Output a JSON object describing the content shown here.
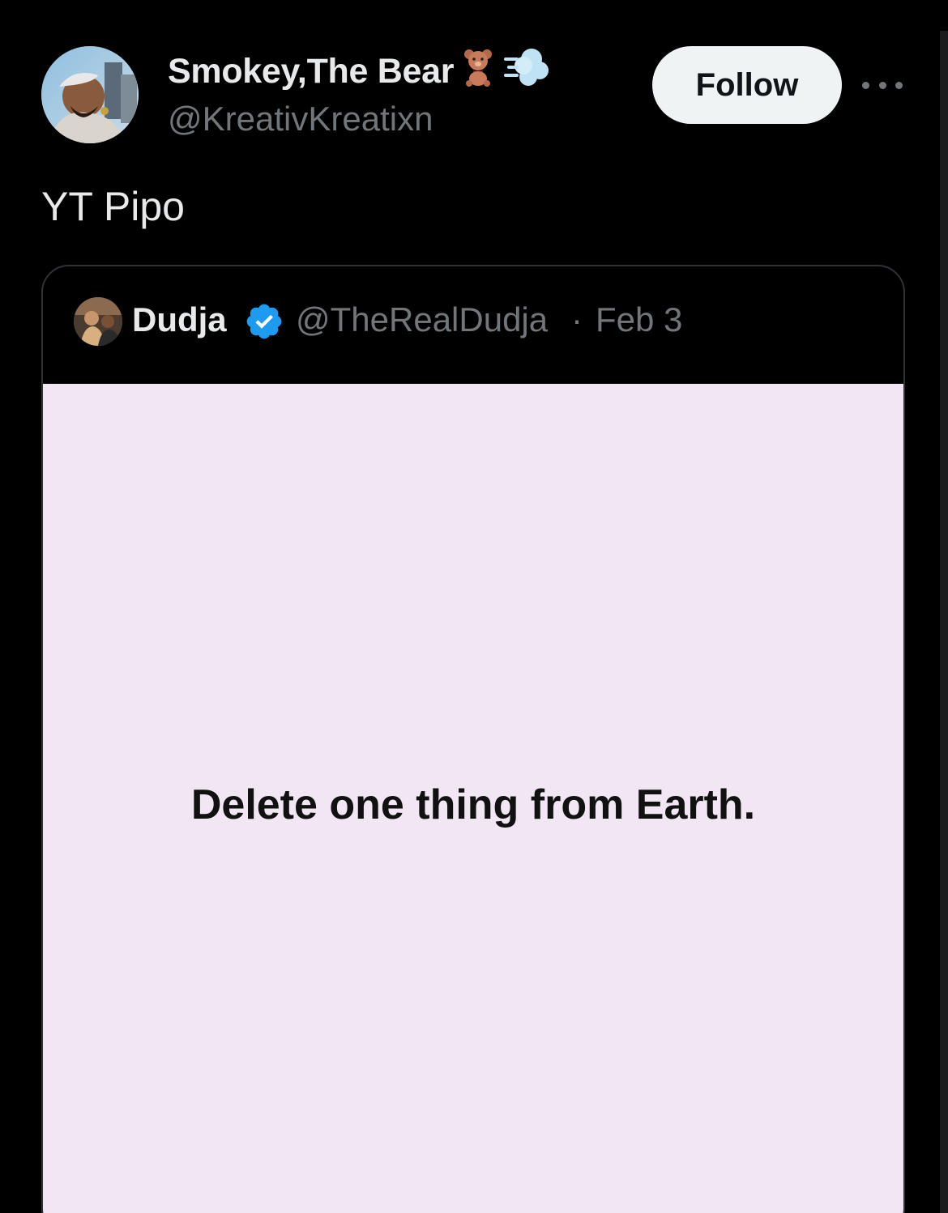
{
  "tweet": {
    "author": {
      "display_name": "Smokey,The Bear",
      "name_emojis": [
        "teddy-bear-icon",
        "dashing-away-icon"
      ],
      "handle": "@KreativKreatixn"
    },
    "follow_label": "Follow",
    "more_icon": "more-horizontal-icon",
    "text": "YT Pipo"
  },
  "quoted_tweet": {
    "author": {
      "display_name": "Dudja",
      "verified": true,
      "handle": "@TheRealDudja"
    },
    "separator": "·",
    "date": "Feb 3",
    "media": {
      "caption": "Delete one thing from Earth.",
      "background": "#f2e6f4"
    }
  },
  "colors": {
    "background": "#000000",
    "primary_text": "#e7e9ea",
    "secondary_text": "#71767b",
    "verified_blue": "#1d9bf0",
    "follow_button_bg": "#eff3f4"
  }
}
